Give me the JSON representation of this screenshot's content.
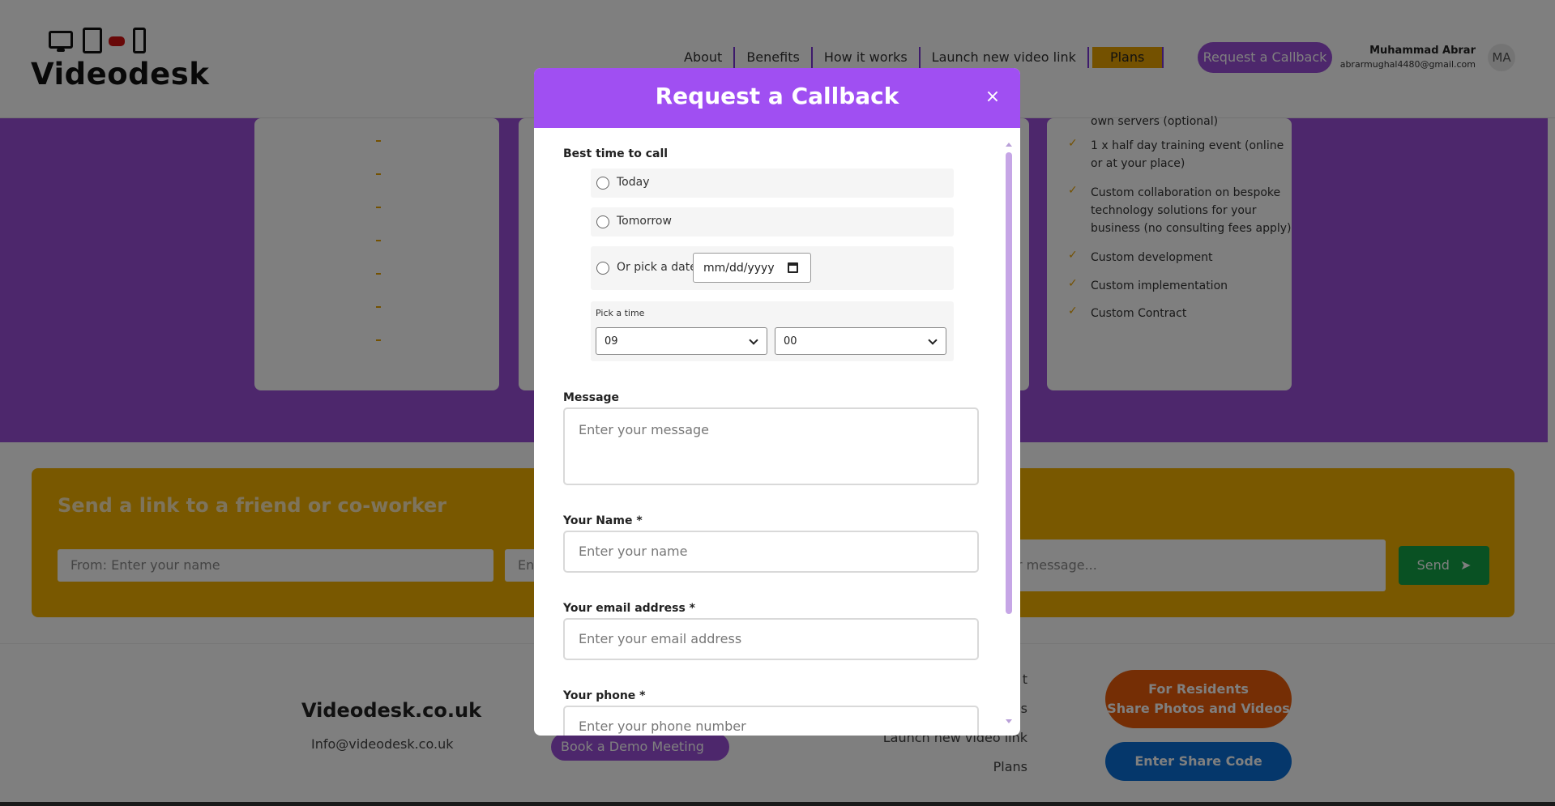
{
  "header": {
    "logo_text": "Videodesk",
    "nav": {
      "about": "About",
      "benefits": "Benefits",
      "how": "How it works",
      "launch": "Launch new video link",
      "plans": "Plans"
    },
    "callback_label": "Request a Callback",
    "user_name": "Muhammad Abrar",
    "user_email": "abrarmughal4480@gmail.com",
    "avatar": "MA"
  },
  "plans": {
    "features": [
      "own servers (optional)",
      "1 x half day training event (online or at your place)",
      "Custom collaboration on bespoke technology solutions for your business (no consulting fees apply)",
      "Custom development",
      "Custom implementation",
      "Custom Contract"
    ],
    "dash": "-"
  },
  "share": {
    "title": "Send a link to a friend or co-worker",
    "from_placeholder": "From: Enter your name",
    "to_partial": "Ent",
    "message_partial": "r message...",
    "send_label": "Send"
  },
  "footer": {
    "brand": "Videodesk.co.uk",
    "email": "Info@videodesk.co.uk",
    "demo_label": "Book a Demo Meeting",
    "links_partial": [
      "t",
      "s"
    ],
    "launch_link": "Launch new video link",
    "plans_link": "Plans",
    "residents_line1": "For Residents",
    "residents_line2": "Share Photos and Videos",
    "share_code_label": "Enter Share Code"
  },
  "modal": {
    "title": "Request a Callback",
    "close_icon": "×",
    "best_time_label": "Best time to call",
    "opt_today": "Today",
    "opt_tomorrow": "Tomorrow",
    "opt_pick_date": "Or pick a date:",
    "date_placeholder": "mm/dd/yyyy",
    "pick_time_label": "Pick a time",
    "hour_value": "09",
    "minute_value": "00",
    "message_label": "Message",
    "message_placeholder": "Enter your message",
    "name_label": "Your Name *",
    "name_placeholder": "Enter your name",
    "email_label": "Your email address *",
    "email_placeholder": "Enter your email address",
    "phone_label": "Your phone *",
    "phone_placeholder": "Enter your phone number"
  },
  "icons": {
    "logo": "devices-icon",
    "close": "close-icon",
    "calendar": "calendar-icon",
    "send": "paper-plane-icon",
    "check": "check-icon"
  },
  "colors": {
    "purple": "#9b4fd8",
    "modal_header": "#a04ff2",
    "amber": "#f2b100",
    "green": "#12a347",
    "orange": "#ea5d0b",
    "blue": "#0a6fd6"
  }
}
